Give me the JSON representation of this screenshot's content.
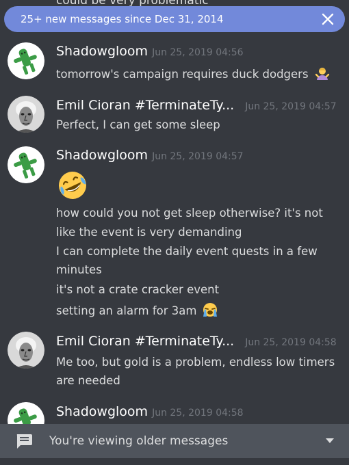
{
  "cut_off_text": "could be very problematic",
  "banner": {
    "text": "25+ new messages since Dec 31, 2014"
  },
  "messages": [
    {
      "author": "Shadowgloom",
      "timestamp": "Jun 25, 2019 04:56",
      "lines": [
        "tomorrow's campaign requires duck dodgers"
      ]
    },
    {
      "author": "Emil Cioran #TerminateTy...",
      "timestamp": "Jun 25, 2019 04:57",
      "lines": [
        "Perfect, I can get some sleep"
      ]
    },
    {
      "author": "Shadowgloom",
      "timestamp": "Jun 25, 2019 04:57",
      "lines": [
        "how could you not get sleep otherwise? it's not",
        "like the event is very demanding",
        "I can complete the daily event quests in a few",
        "minutes",
        "it's not a crate cracker event",
        "setting an alarm for 3am"
      ]
    },
    {
      "author": "Emil Cioran #TerminateTy...",
      "timestamp": "Jun 25, 2019 04:58",
      "lines": [
        "Me too, but gold is a problem, endless low timers",
        "are needed"
      ]
    },
    {
      "author": "Shadowgloom",
      "timestamp": "Jun 25, 2019 04:58",
      "lines": []
    }
  ],
  "emojis": {
    "shrug": "person-shrugging-emoji",
    "laughing": "rolling-on-floor-laughing-emoji",
    "crying": "loudly-crying-emoji"
  },
  "footer": {
    "text": "You're viewing older messages"
  },
  "colors": {
    "background": "#36393f",
    "banner": "#7289da",
    "footer": "#4f545c",
    "timestamp": "#72767d",
    "cactuar": "#3c9c46"
  }
}
